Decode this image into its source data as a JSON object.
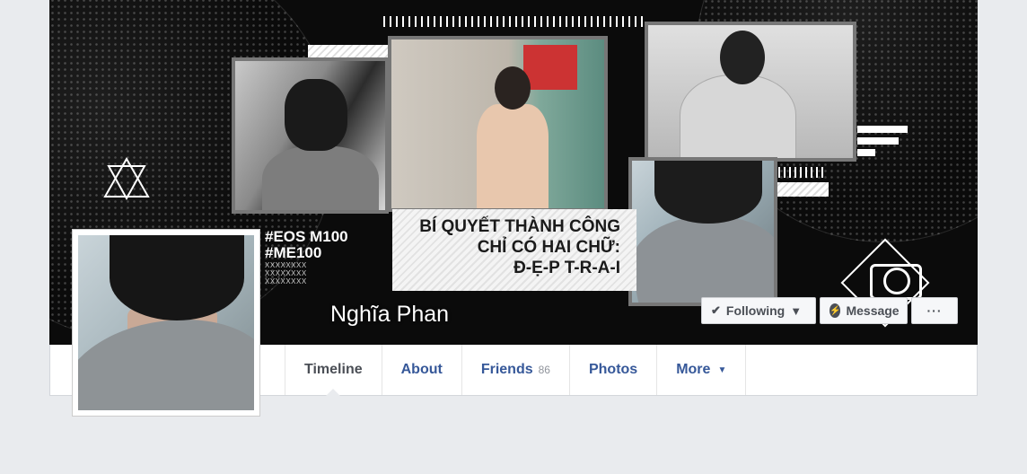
{
  "profile": {
    "name": "Nghĩa Phan"
  },
  "cover": {
    "hashtag_1": "#EOS M100",
    "hashtag_2": "#ME100",
    "tiny_1": "XXXXXXXX",
    "tiny_2": "XXXXXXXX",
    "tiny_3": "XXXXXXXX",
    "caption_line_1": "BÍ QUYẾT THÀNH CÔNG",
    "caption_line_2": "CHỈ CÓ HAI CHỮ:",
    "caption_line_3": "Đ-Ẹ-P T-R-A-I"
  },
  "actions": {
    "following_label": "Following",
    "message_label": "Message",
    "more_label": "···"
  },
  "nav": {
    "tabs": [
      {
        "label": "Timeline"
      },
      {
        "label": "About"
      },
      {
        "label": "Friends",
        "count": "86"
      },
      {
        "label": "Photos"
      },
      {
        "label": "More"
      }
    ]
  },
  "colors": {
    "link": "#365899",
    "page_bg": "#e9ebee",
    "cover_bg": "#0b0b0b"
  }
}
